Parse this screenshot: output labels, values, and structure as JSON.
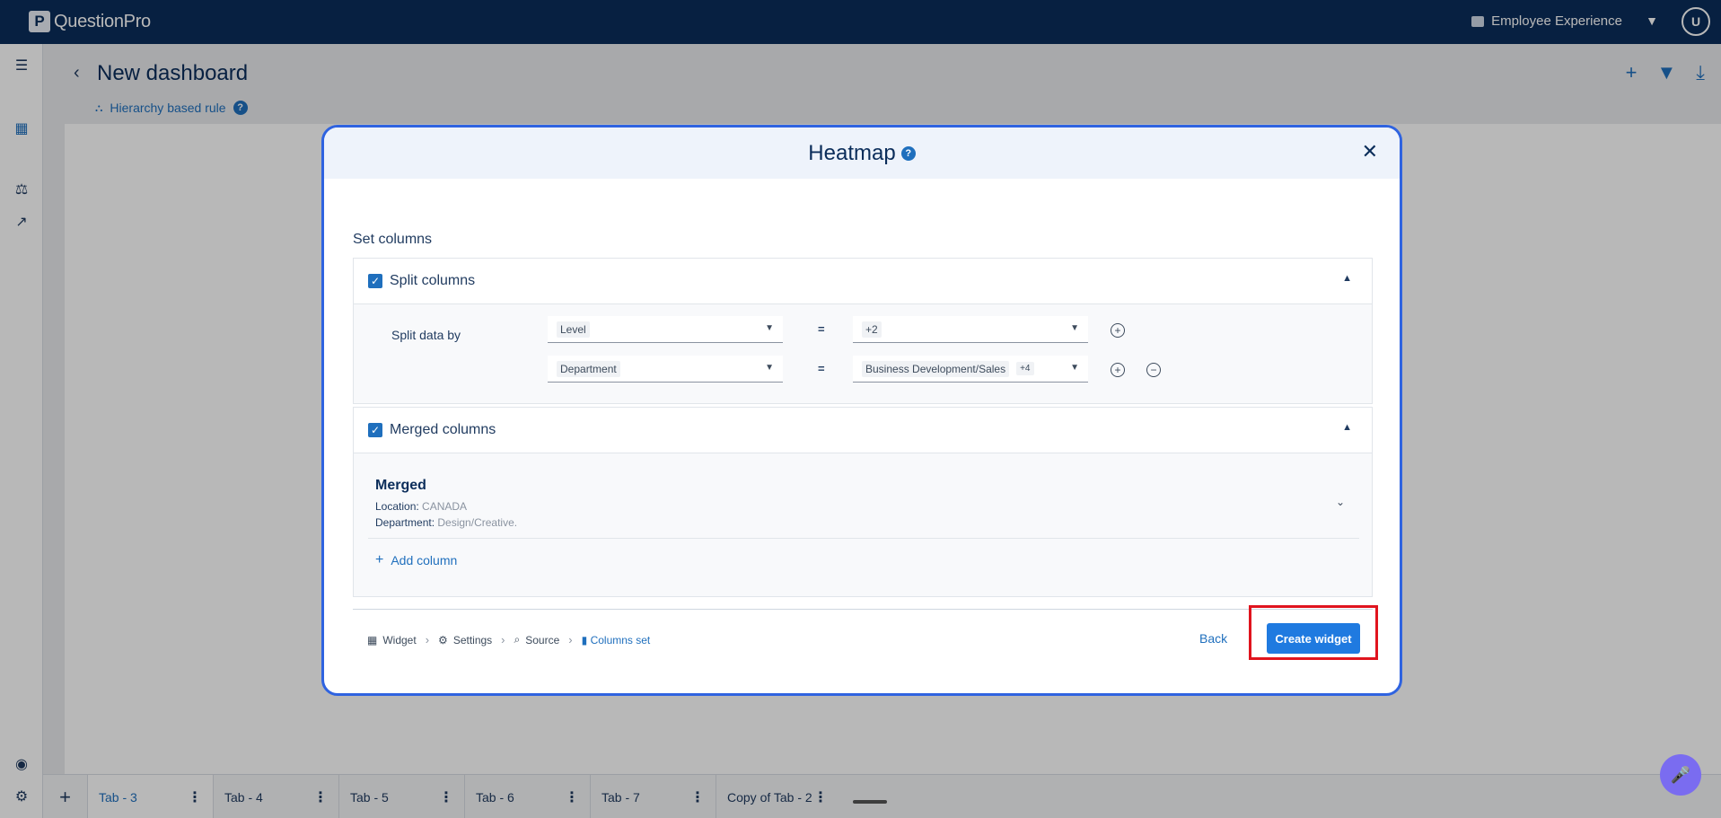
{
  "app": {
    "logo_letter": "P",
    "logo_text": "QuestionPro",
    "product": "Employee Experience",
    "user_initial": "U"
  },
  "header": {
    "title": "New dashboard",
    "rule_label": "Hierarchy based rule",
    "help": "?"
  },
  "modal": {
    "title": "Heatmap",
    "help": "?",
    "section_label": "Set columns",
    "split": {
      "label": "Split columns",
      "data_label": "Split data by",
      "rows": [
        {
          "field": "Level",
          "op": "=",
          "value": "+2",
          "extra": ""
        },
        {
          "field": "Department",
          "op": "=",
          "value": "Business Development/Sales",
          "extra": "+4"
        }
      ]
    },
    "merged": {
      "label": "Merged columns",
      "item_name": "Merged",
      "location_key": "Location:",
      "location_val": "CANADA",
      "department_key": "Department:",
      "department_val": "Design/Creative.",
      "add_column": "Add column"
    },
    "breadcrumb": [
      "Widget",
      "Settings",
      "Source",
      "Columns set"
    ],
    "back": "Back",
    "create": "Create widget"
  },
  "tabs": [
    "Tab - 3",
    "Tab - 4",
    "Tab - 5",
    "Tab - 6",
    "Tab - 7",
    "Copy of Tab - 2"
  ],
  "colors": {
    "topbar": "#0b2d5a",
    "accent": "#1f7ae0",
    "highlight": "#e0141e",
    "modal_border": "#2f63e0"
  }
}
